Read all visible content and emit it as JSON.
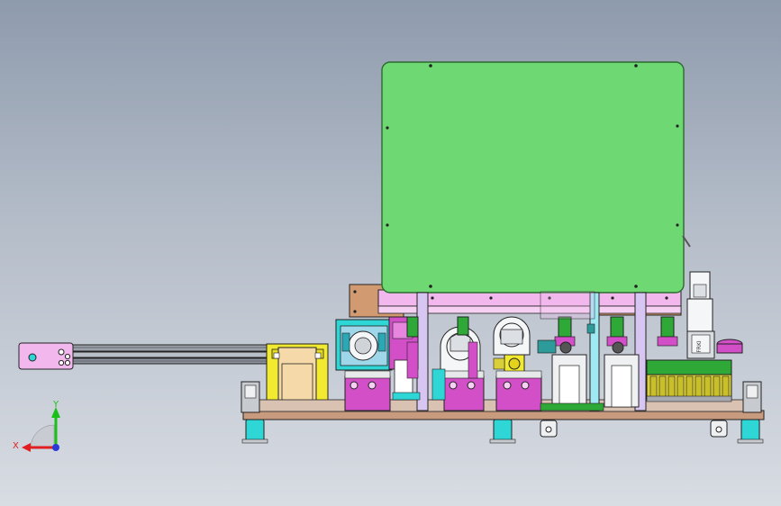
{
  "viewport": {
    "background": "#aab3c1",
    "model": "machine-assembly-front-view"
  },
  "colors": {
    "green_panel": "#6ed872",
    "green_edge": "#2d6a30",
    "frame_pink": "#f2b8ee",
    "magenta": "#d24fc7",
    "orange_wood": "#d29a70",
    "yellow": "#f1ea30",
    "cream": "#f6d9a8",
    "cyan": "#2fd6d6",
    "base_plate": "#c89a7e",
    "steel": "#c7cbd0",
    "rail": "#6c7380",
    "small_yellow": "#d8cf3a"
  },
  "triad": {
    "x_label": "X",
    "y_label": "Y",
    "x_color": "#e02020",
    "y_color": "#18c018",
    "z_color": "#2b3bd8",
    "icon": "coordinate-triad-icon"
  },
  "label_plate": {
    "text": "FRKI"
  }
}
